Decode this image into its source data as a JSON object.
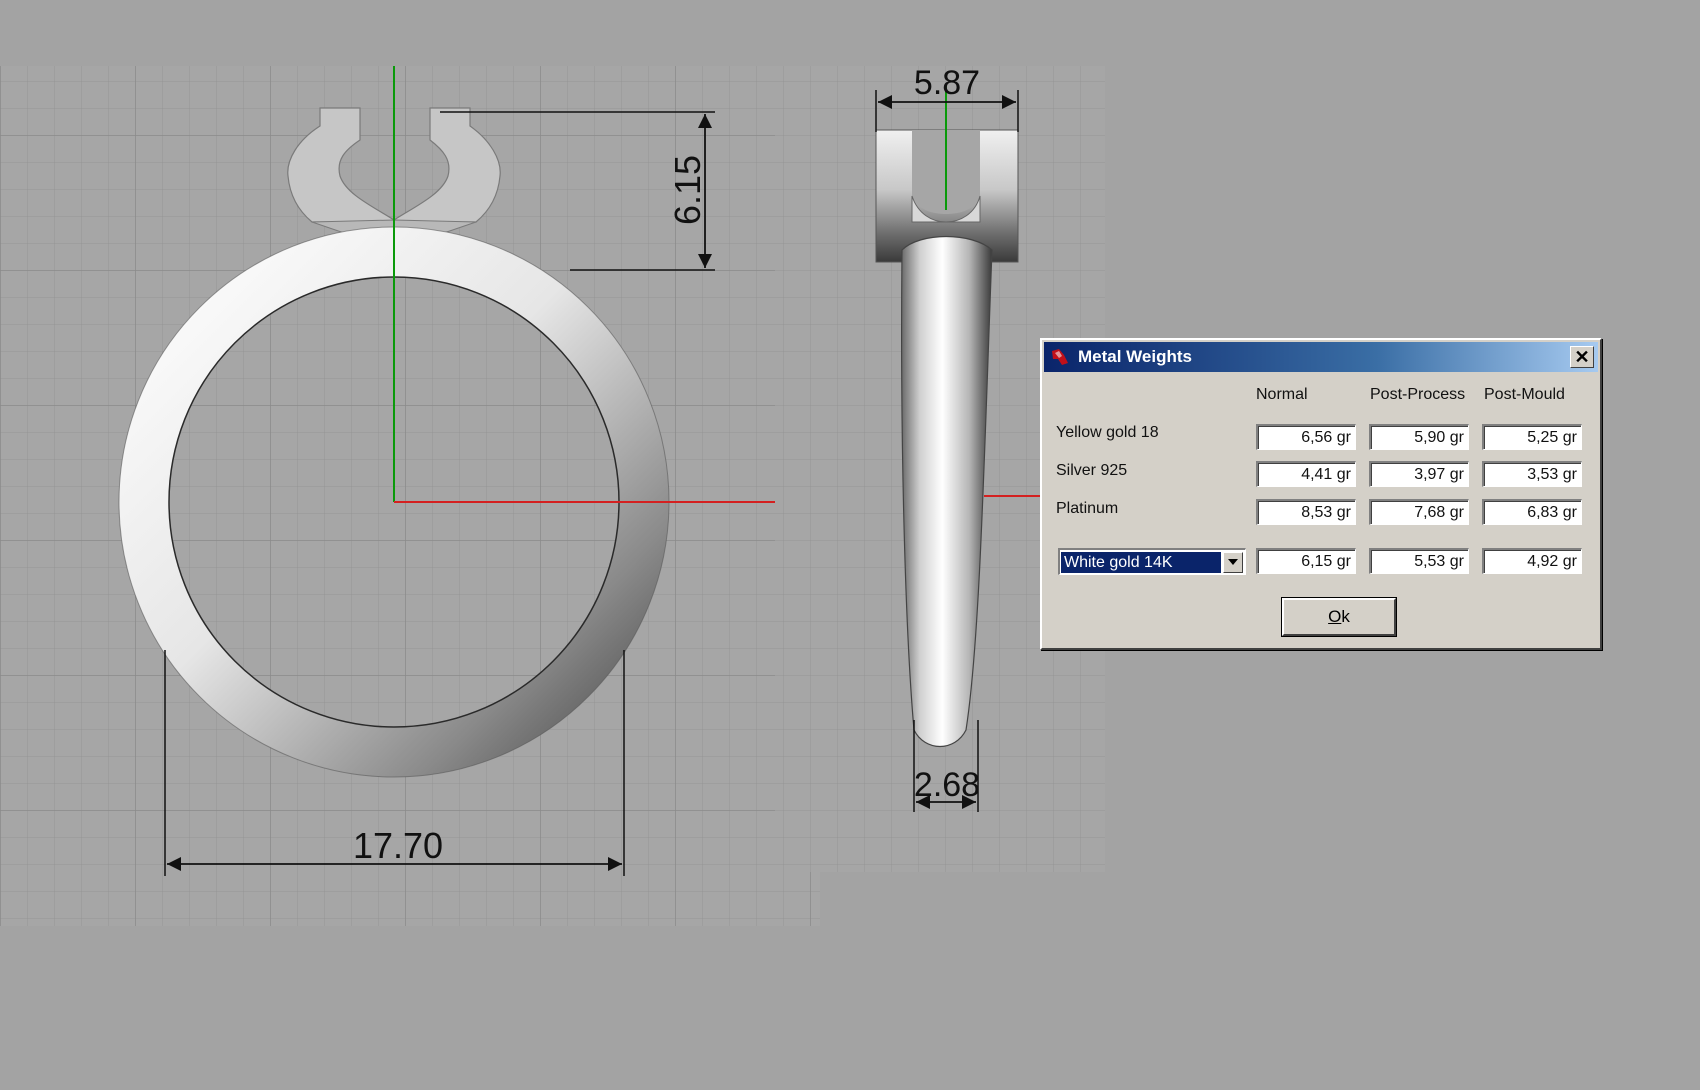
{
  "viewport": {
    "front_view": {
      "width_dimension": "17.70",
      "height_dimension": "6.15"
    },
    "side_view": {
      "top_width_dimension": "5.87",
      "bottom_width_dimension": "2.68"
    },
    "colors": {
      "axis_y": "#0a9a0a",
      "axis_x": "#d42020",
      "background": "#a3a3a3",
      "grid": "#8f8f8f"
    }
  },
  "dialog": {
    "title": "Metal Weights",
    "app_icon": "rhino-icon",
    "close_label": "✕",
    "columns": [
      "Normal",
      "Post-Process",
      "Post-Mould"
    ],
    "rows": [
      {
        "label": "Yellow gold 18",
        "values": [
          "6,56 gr",
          "5,90 gr",
          "5,25 gr"
        ]
      },
      {
        "label": "Silver 925",
        "values": [
          "4,41 gr",
          "3,97 gr",
          "3,53 gr"
        ]
      },
      {
        "label": "Platinum",
        "values": [
          "8,53 gr",
          "7,68 gr",
          "6,83 gr"
        ]
      }
    ],
    "custom_row": {
      "selected_metal": "White gold 14K",
      "values": [
        "6,15 gr",
        "5,53 gr",
        "4,92 gr"
      ]
    },
    "ok_label_first": "O",
    "ok_label_rest": "k"
  }
}
